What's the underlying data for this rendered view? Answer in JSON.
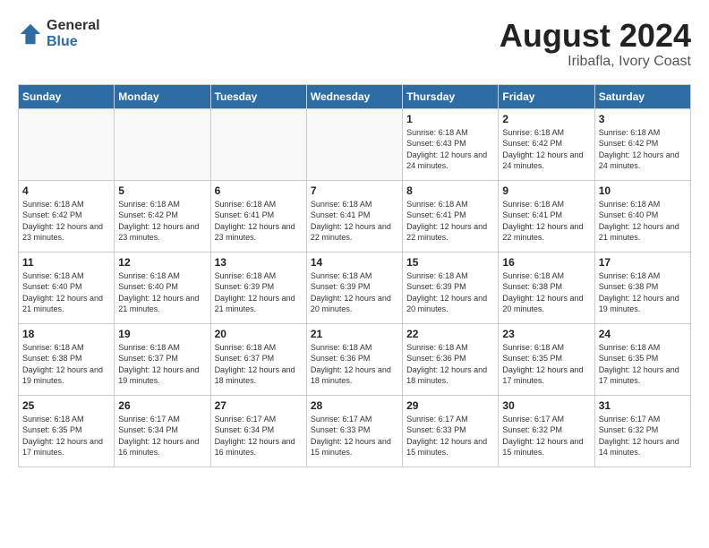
{
  "header": {
    "logo_general": "General",
    "logo_blue": "Blue",
    "title": "August 2024",
    "location": "Iribafla, Ivory Coast"
  },
  "weekdays": [
    "Sunday",
    "Monday",
    "Tuesday",
    "Wednesday",
    "Thursday",
    "Friday",
    "Saturday"
  ],
  "weeks": [
    [
      {
        "num": "",
        "info": ""
      },
      {
        "num": "",
        "info": ""
      },
      {
        "num": "",
        "info": ""
      },
      {
        "num": "",
        "info": ""
      },
      {
        "num": "1",
        "info": "Sunrise: 6:18 AM\nSunset: 6:43 PM\nDaylight: 12 hours\nand 24 minutes."
      },
      {
        "num": "2",
        "info": "Sunrise: 6:18 AM\nSunset: 6:42 PM\nDaylight: 12 hours\nand 24 minutes."
      },
      {
        "num": "3",
        "info": "Sunrise: 6:18 AM\nSunset: 6:42 PM\nDaylight: 12 hours\nand 24 minutes."
      }
    ],
    [
      {
        "num": "4",
        "info": "Sunrise: 6:18 AM\nSunset: 6:42 PM\nDaylight: 12 hours\nand 23 minutes."
      },
      {
        "num": "5",
        "info": "Sunrise: 6:18 AM\nSunset: 6:42 PM\nDaylight: 12 hours\nand 23 minutes."
      },
      {
        "num": "6",
        "info": "Sunrise: 6:18 AM\nSunset: 6:41 PM\nDaylight: 12 hours\nand 23 minutes."
      },
      {
        "num": "7",
        "info": "Sunrise: 6:18 AM\nSunset: 6:41 PM\nDaylight: 12 hours\nand 22 minutes."
      },
      {
        "num": "8",
        "info": "Sunrise: 6:18 AM\nSunset: 6:41 PM\nDaylight: 12 hours\nand 22 minutes."
      },
      {
        "num": "9",
        "info": "Sunrise: 6:18 AM\nSunset: 6:41 PM\nDaylight: 12 hours\nand 22 minutes."
      },
      {
        "num": "10",
        "info": "Sunrise: 6:18 AM\nSunset: 6:40 PM\nDaylight: 12 hours\nand 21 minutes."
      }
    ],
    [
      {
        "num": "11",
        "info": "Sunrise: 6:18 AM\nSunset: 6:40 PM\nDaylight: 12 hours\nand 21 minutes."
      },
      {
        "num": "12",
        "info": "Sunrise: 6:18 AM\nSunset: 6:40 PM\nDaylight: 12 hours\nand 21 minutes."
      },
      {
        "num": "13",
        "info": "Sunrise: 6:18 AM\nSunset: 6:39 PM\nDaylight: 12 hours\nand 21 minutes."
      },
      {
        "num": "14",
        "info": "Sunrise: 6:18 AM\nSunset: 6:39 PM\nDaylight: 12 hours\nand 20 minutes."
      },
      {
        "num": "15",
        "info": "Sunrise: 6:18 AM\nSunset: 6:39 PM\nDaylight: 12 hours\nand 20 minutes."
      },
      {
        "num": "16",
        "info": "Sunrise: 6:18 AM\nSunset: 6:38 PM\nDaylight: 12 hours\nand 20 minutes."
      },
      {
        "num": "17",
        "info": "Sunrise: 6:18 AM\nSunset: 6:38 PM\nDaylight: 12 hours\nand 19 minutes."
      }
    ],
    [
      {
        "num": "18",
        "info": "Sunrise: 6:18 AM\nSunset: 6:38 PM\nDaylight: 12 hours\nand 19 minutes."
      },
      {
        "num": "19",
        "info": "Sunrise: 6:18 AM\nSunset: 6:37 PM\nDaylight: 12 hours\nand 19 minutes."
      },
      {
        "num": "20",
        "info": "Sunrise: 6:18 AM\nSunset: 6:37 PM\nDaylight: 12 hours\nand 18 minutes."
      },
      {
        "num": "21",
        "info": "Sunrise: 6:18 AM\nSunset: 6:36 PM\nDaylight: 12 hours\nand 18 minutes."
      },
      {
        "num": "22",
        "info": "Sunrise: 6:18 AM\nSunset: 6:36 PM\nDaylight: 12 hours\nand 18 minutes."
      },
      {
        "num": "23",
        "info": "Sunrise: 6:18 AM\nSunset: 6:35 PM\nDaylight: 12 hours\nand 17 minutes."
      },
      {
        "num": "24",
        "info": "Sunrise: 6:18 AM\nSunset: 6:35 PM\nDaylight: 12 hours\nand 17 minutes."
      }
    ],
    [
      {
        "num": "25",
        "info": "Sunrise: 6:18 AM\nSunset: 6:35 PM\nDaylight: 12 hours\nand 17 minutes."
      },
      {
        "num": "26",
        "info": "Sunrise: 6:17 AM\nSunset: 6:34 PM\nDaylight: 12 hours\nand 16 minutes."
      },
      {
        "num": "27",
        "info": "Sunrise: 6:17 AM\nSunset: 6:34 PM\nDaylight: 12 hours\nand 16 minutes."
      },
      {
        "num": "28",
        "info": "Sunrise: 6:17 AM\nSunset: 6:33 PM\nDaylight: 12 hours\nand 15 minutes."
      },
      {
        "num": "29",
        "info": "Sunrise: 6:17 AM\nSunset: 6:33 PM\nDaylight: 12 hours\nand 15 minutes."
      },
      {
        "num": "30",
        "info": "Sunrise: 6:17 AM\nSunset: 6:32 PM\nDaylight: 12 hours\nand 15 minutes."
      },
      {
        "num": "31",
        "info": "Sunrise: 6:17 AM\nSunset: 6:32 PM\nDaylight: 12 hours\nand 14 minutes."
      }
    ]
  ]
}
